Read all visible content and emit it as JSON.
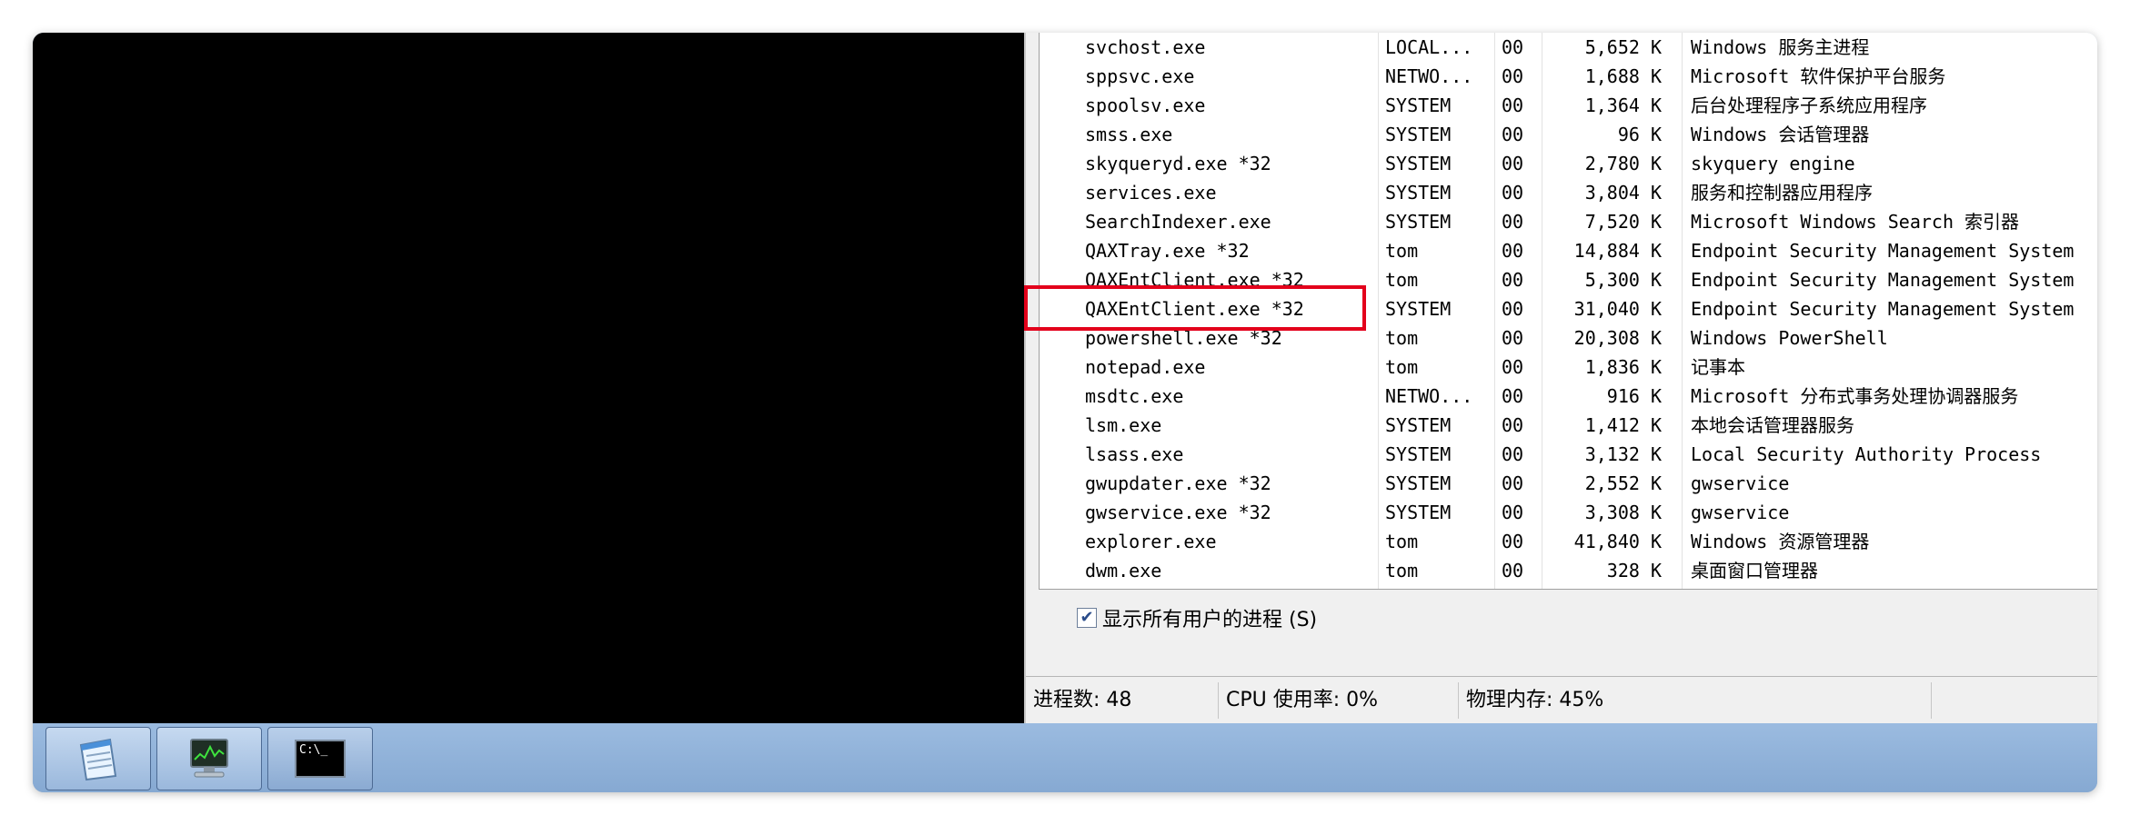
{
  "processes": [
    {
      "name": "svchost.exe",
      "user": "LOCAL...",
      "cpu": "00",
      "mem": "5,652 K",
      "desc": "Windows 服务主进程"
    },
    {
      "name": "sppsvc.exe",
      "user": "NETWO...",
      "cpu": "00",
      "mem": "1,688 K",
      "desc": "Microsoft 软件保护平台服务"
    },
    {
      "name": "spoolsv.exe",
      "user": "SYSTEM",
      "cpu": "00",
      "mem": "1,364 K",
      "desc": "后台处理程序子系统应用程序"
    },
    {
      "name": "smss.exe",
      "user": "SYSTEM",
      "cpu": "00",
      "mem": "96 K",
      "desc": "Windows 会话管理器"
    },
    {
      "name": "skyqueryd.exe *32",
      "user": "SYSTEM",
      "cpu": "00",
      "mem": "2,780 K",
      "desc": "skyquery engine"
    },
    {
      "name": "services.exe",
      "user": "SYSTEM",
      "cpu": "00",
      "mem": "3,804 K",
      "desc": "服务和控制器应用程序"
    },
    {
      "name": "SearchIndexer.exe",
      "user": "SYSTEM",
      "cpu": "00",
      "mem": "7,520 K",
      "desc": "Microsoft Windows Search 索引器"
    },
    {
      "name": "QAXTray.exe *32",
      "user": "tom",
      "cpu": "00",
      "mem": "14,884 K",
      "desc": "Endpoint Security Management System"
    },
    {
      "name": "QAXEntClient.exe *32",
      "user": "tom",
      "cpu": "00",
      "mem": "5,300 K",
      "desc": "Endpoint Security Management System"
    },
    {
      "name": "QAXEntClient.exe *32",
      "user": "SYSTEM",
      "cpu": "00",
      "mem": "31,040 K",
      "desc": "Endpoint Security Management System"
    },
    {
      "name": "powershell.exe *32",
      "user": "tom",
      "cpu": "00",
      "mem": "20,308 K",
      "desc": "Windows PowerShell"
    },
    {
      "name": "notepad.exe",
      "user": "tom",
      "cpu": "00",
      "mem": "1,836 K",
      "desc": "记事本"
    },
    {
      "name": "msdtc.exe",
      "user": "NETWO...",
      "cpu": "00",
      "mem": "916 K",
      "desc": "Microsoft 分布式事务处理协调器服务"
    },
    {
      "name": "lsm.exe",
      "user": "SYSTEM",
      "cpu": "00",
      "mem": "1,412 K",
      "desc": "本地会话管理器服务"
    },
    {
      "name": "lsass.exe",
      "user": "SYSTEM",
      "cpu": "00",
      "mem": "3,132 K",
      "desc": "Local Security Authority Process"
    },
    {
      "name": "gwupdater.exe *32",
      "user": "SYSTEM",
      "cpu": "00",
      "mem": "2,552 K",
      "desc": "gwservice"
    },
    {
      "name": "gwservice.exe *32",
      "user": "SYSTEM",
      "cpu": "00",
      "mem": "3,308 K",
      "desc": "gwservice"
    },
    {
      "name": "explorer.exe",
      "user": "tom",
      "cpu": "00",
      "mem": "41,840 K",
      "desc": "Windows 资源管理器"
    },
    {
      "name": "dwm.exe",
      "user": "tom",
      "cpu": "00",
      "mem": "328 K",
      "desc": "桌面窗口管理器"
    }
  ],
  "show_all_users": {
    "label": "显示所有用户的进程 (S)",
    "checked": true
  },
  "status": {
    "process_count": "进程数: 48",
    "cpu_usage": "CPU 使用率: 0%",
    "physical_memory": "物理内存: 45%"
  },
  "taskbar": {
    "items": [
      {
        "icon": "notepad-icon"
      },
      {
        "icon": "task-manager-icon"
      },
      {
        "icon": "command-prompt-icon",
        "glyph": "C:\\_"
      }
    ]
  },
  "highlight_color": "#e3001b"
}
